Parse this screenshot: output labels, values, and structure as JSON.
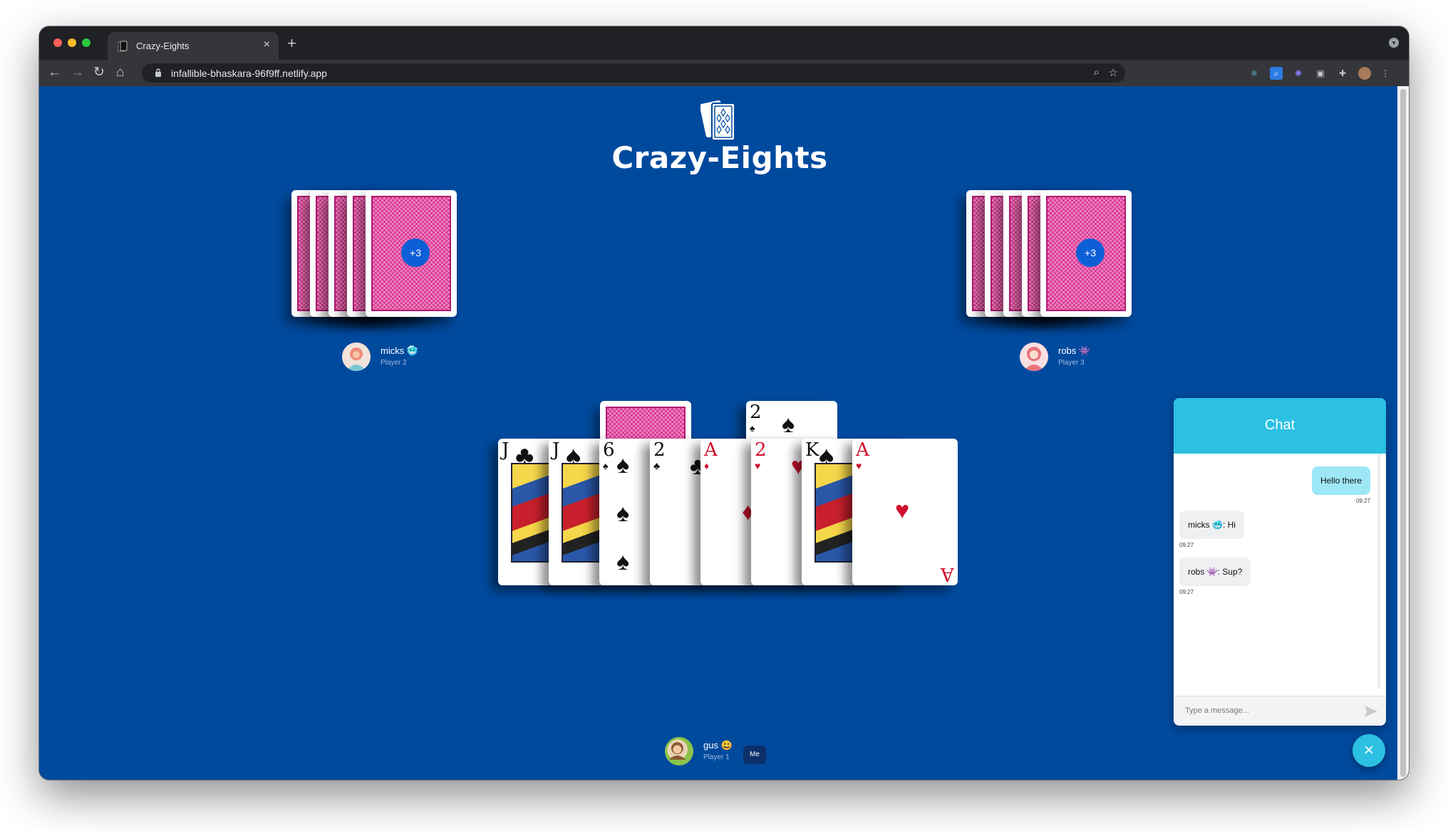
{
  "browser": {
    "tab_title": "Crazy-Eights",
    "tab_close": "×",
    "new_tab": "+",
    "url": "infallible-bhaskara-96f9ff.netlify.app"
  },
  "game": {
    "title": "Crazy-Eights",
    "opponents": [
      {
        "name": "micks 🥶",
        "role": "Player 2",
        "extra_cards": "+3"
      },
      {
        "name": "robs 👾",
        "role": "Player 3",
        "extra_cards": "+3"
      }
    ],
    "discard_top": {
      "rank": "2",
      "suit": "♠"
    },
    "hand": [
      {
        "rank": "J",
        "suit": "♣",
        "color": "black"
      },
      {
        "rank": "J",
        "suit": "♠",
        "color": "black"
      },
      {
        "rank": "6",
        "suit": "♠",
        "color": "black"
      },
      {
        "rank": "2",
        "suit": "♣",
        "color": "black"
      },
      {
        "rank": "A",
        "suit": "♦",
        "color": "red"
      },
      {
        "rank": "2",
        "suit": "♥",
        "color": "red"
      },
      {
        "rank": "K",
        "suit": "♠",
        "color": "black"
      },
      {
        "rank": "A",
        "suit": "♥",
        "color": "red"
      }
    ],
    "me": {
      "name": "gus 😃",
      "role": "Player 1",
      "badge": "Me"
    }
  },
  "chat": {
    "title": "Chat",
    "messages": [
      {
        "text": "Hello there",
        "time": "09:27",
        "direction": "out"
      },
      {
        "text": "micks 🥶: Hi",
        "time": "09:27",
        "direction": "in"
      },
      {
        "text": "robs 👾: Sup?",
        "time": "09:27",
        "direction": "in"
      }
    ],
    "input_placeholder": "Type a message...",
    "close_button": "×"
  },
  "colors": {
    "table": "#004a9e",
    "chat_accent": "#2cc0e3",
    "card_back": "#de3c97"
  }
}
